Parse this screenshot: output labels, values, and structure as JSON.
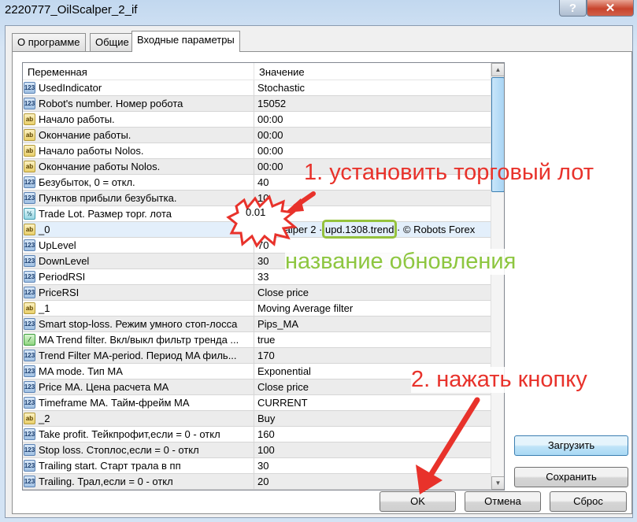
{
  "window": {
    "title": "2220777_OilScalper_2_if",
    "help": "?",
    "close": "✕"
  },
  "tabs": [
    {
      "label": "О программе"
    },
    {
      "label": "Общие"
    },
    {
      "label": "Входные параметры"
    }
  ],
  "table": {
    "headers": [
      "Переменная",
      "Значение"
    ],
    "rows": [
      {
        "icon": "int",
        "label": "123",
        "name": "UsedIndicator",
        "value": "Stochastic"
      },
      {
        "icon": "int",
        "label": "123",
        "name": "Robot's number. Номер робота",
        "value": "15052"
      },
      {
        "icon": "ab",
        "label": "ab",
        "name": "Начало работы.",
        "value": "00:00"
      },
      {
        "icon": "ab",
        "label": "ab",
        "name": "Окончание работы.",
        "value": "00:00"
      },
      {
        "icon": "ab",
        "label": "ab",
        "name": "Начало работы Nolos.",
        "value": "00:00"
      },
      {
        "icon": "ab",
        "label": "ab",
        "name": "Окончание работы Nolos.",
        "value": "00:00"
      },
      {
        "icon": "int",
        "label": "123",
        "name": "Безубыток, 0 = откл.",
        "value": "40"
      },
      {
        "icon": "int",
        "label": "123",
        "name": "Пунктов прибыли безубытка.",
        "value": "10"
      },
      {
        "icon": "dbl",
        "label": "½",
        "name": "Trade Lot. Размер торг. лота",
        "value": "0.01"
      },
      {
        "icon": "ab",
        "label": "ab",
        "name": "_0",
        "value": "Oil Scalper 2 · upd.1308.trend · © Robots Forex",
        "selected": true
      },
      {
        "icon": "int",
        "label": "123",
        "name": "UpLevel",
        "value": "70"
      },
      {
        "icon": "int",
        "label": "123",
        "name": "DownLevel",
        "value": "30"
      },
      {
        "icon": "int",
        "label": "123",
        "name": "PeriodRSI",
        "value": "33"
      },
      {
        "icon": "int",
        "label": "123",
        "name": "PriceRSI",
        "value": "Close price"
      },
      {
        "icon": "ab",
        "label": "ab",
        "name": "_1",
        "value": "Moving Average filter"
      },
      {
        "icon": "int",
        "label": "123",
        "name": "Smart stop-loss. Режим умного стоп-лосса",
        "value": "Pips_MA"
      },
      {
        "icon": "bool",
        "label": "⁄",
        "name": "MA Trend filter. Вкл/выкл фильтр тренда ...",
        "value": "true"
      },
      {
        "icon": "int",
        "label": "123",
        "name": "Trend Filter MA-period. Период MA филь...",
        "value": "170"
      },
      {
        "icon": "int",
        "label": "123",
        "name": "MA mode. Тип MA",
        "value": "Exponential"
      },
      {
        "icon": "int",
        "label": "123",
        "name": "Price MA. Цена расчета MA",
        "value": "Close price"
      },
      {
        "icon": "int",
        "label": "123",
        "name": "Timeframe MA. Тайм-фрейм MA",
        "value": "CURRENT"
      },
      {
        "icon": "ab",
        "label": "ab",
        "name": "_2",
        "value": "Buy"
      },
      {
        "icon": "int",
        "label": "123",
        "name": "Take profit. Тейкпрофит,если = 0 - откл",
        "value": "160"
      },
      {
        "icon": "int",
        "label": "123",
        "name": "Stop loss. Стоплос,если = 0 - откл",
        "value": "100"
      },
      {
        "icon": "int",
        "label": "123",
        "name": "Trailing start. Старт трала в пп",
        "value": "30"
      },
      {
        "icon": "int",
        "label": "123",
        "name": "Trailing. Трал,если = 0 - откл",
        "value": "20"
      }
    ]
  },
  "buttons": {
    "load": "Загрузить",
    "save": "Сохранить",
    "ok": "OK",
    "cancel": "Отмена",
    "reset": "Сброс"
  },
  "annotations": {
    "step1": "1. установить торговый лот",
    "update_name": "название обновления",
    "step2": "2. нажать кнопку",
    "red": "#e8322b",
    "green": "#8dc63f"
  }
}
